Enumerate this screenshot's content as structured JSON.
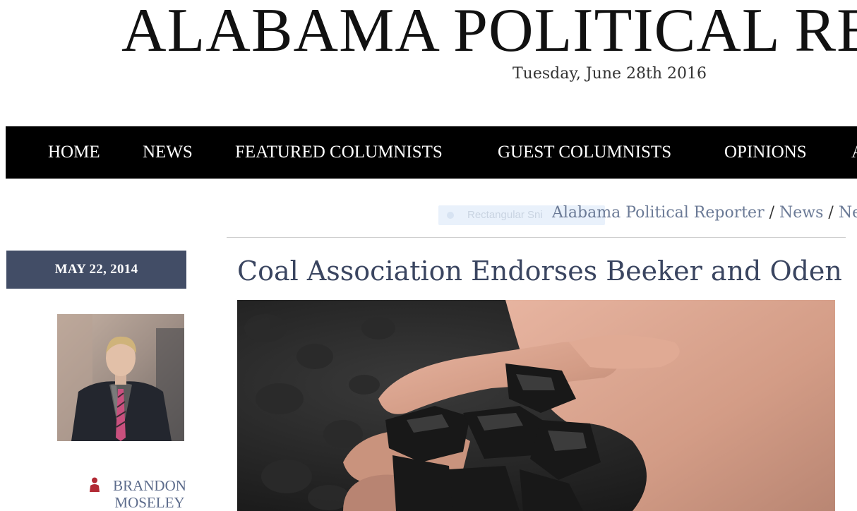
{
  "masthead": {
    "title": "ALABAMA POLITICAL RE",
    "date": "Tuesday, June 28th 2016"
  },
  "nav": {
    "items": [
      {
        "label": "HOME"
      },
      {
        "label": "NEWS"
      },
      {
        "label": "FEATURED COLUMNISTS"
      },
      {
        "label": "GUEST COLUMNISTS"
      },
      {
        "label": "OPINIONS"
      },
      {
        "label": "A"
      }
    ]
  },
  "snip_overlay": {
    "text": "Rectangular Sni"
  },
  "breadcrumb": {
    "items": [
      "Alabama Political Reporter",
      "News",
      "New"
    ],
    "separator": "/"
  },
  "sidebar": {
    "date": "MAY 22, 2014",
    "author_name": "BRANDON MOSELEY",
    "author_icon": "person-icon"
  },
  "article": {
    "title": "Coal Association Endorses Beeker and Oden"
  },
  "colors": {
    "navbar": "#000000",
    "date_box": "#424d66",
    "title": "#3a4560",
    "link": "#6b7a96",
    "author_icon": "#b22a35"
  }
}
